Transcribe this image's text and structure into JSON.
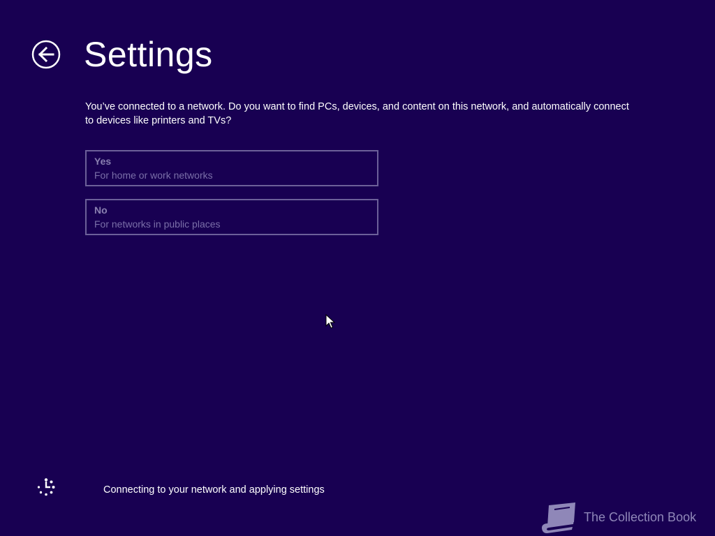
{
  "header": {
    "back_icon": "back-arrow-icon",
    "title": "Settings"
  },
  "main": {
    "description": "You’ve connected to a network. Do you want to find PCs, devices, and content on this network, and automatically connect to devices like printers and TVs?",
    "options": [
      {
        "title": "Yes",
        "subtitle": "For home or work networks"
      },
      {
        "title": "No",
        "subtitle": "For networks in public places"
      }
    ]
  },
  "footer": {
    "spinner_icon": "loading-spinner-icon",
    "status": "Connecting to your network and applying settings"
  },
  "watermark": {
    "icon": "book-icon",
    "text": "The Collection Book"
  },
  "colors": {
    "background": "#180052",
    "option_border": "#6c6099",
    "option_text": "#8a80b1"
  }
}
